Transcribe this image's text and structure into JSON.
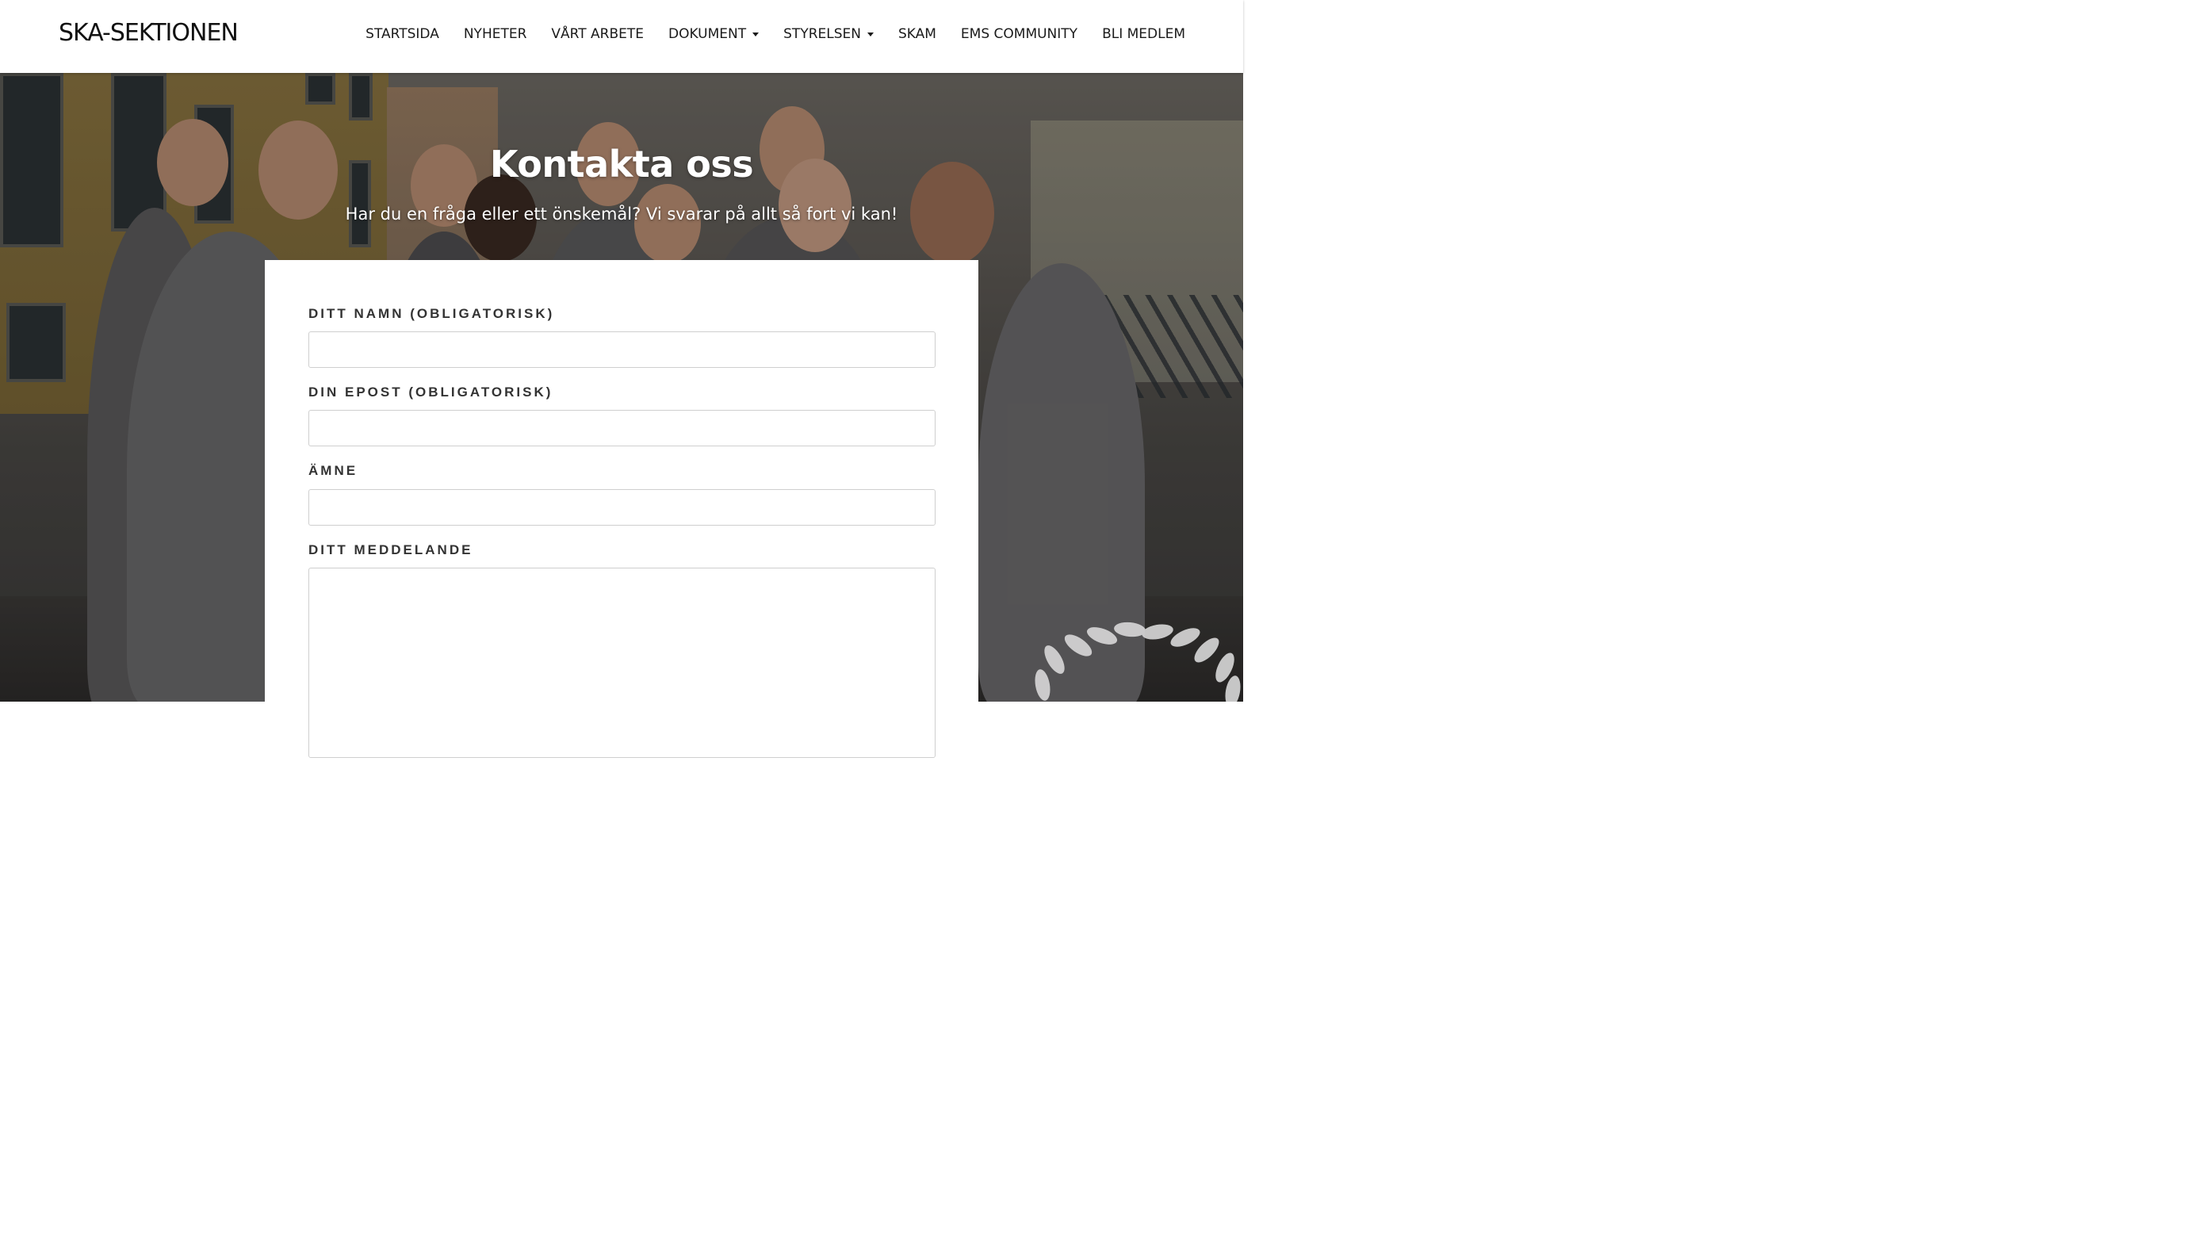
{
  "header": {
    "logo": "SKA-SEKTIONEN",
    "nav": [
      {
        "label": "STARTSIDA",
        "dropdown": false
      },
      {
        "label": "NYHETER",
        "dropdown": false
      },
      {
        "label": "VÅRT ARBETE",
        "dropdown": false
      },
      {
        "label": "DOKUMENT",
        "dropdown": true
      },
      {
        "label": "STYRELSEN",
        "dropdown": true
      },
      {
        "label": "SKAM",
        "dropdown": false
      },
      {
        "label": "EMS COMMUNITY",
        "dropdown": false
      },
      {
        "label": "BLI MEDLEM",
        "dropdown": false
      }
    ]
  },
  "hero": {
    "title": "Kontakta oss",
    "subtitle": "Har du en fråga eller ett önskemål? Vi svarar på allt så fort vi kan!"
  },
  "form": {
    "name_label": "DITT NAMN (OBLIGATORISK)",
    "name_value": "",
    "email_label": "DIN EPOST (OBLIGATORISK)",
    "email_value": "",
    "subject_label": "ÄMNE",
    "subject_value": "",
    "message_label": "DITT MEDDELANDE",
    "message_value": ""
  },
  "icons": {
    "caret": "chevron-down-icon",
    "wreath": "laurel-wreath-icon"
  }
}
